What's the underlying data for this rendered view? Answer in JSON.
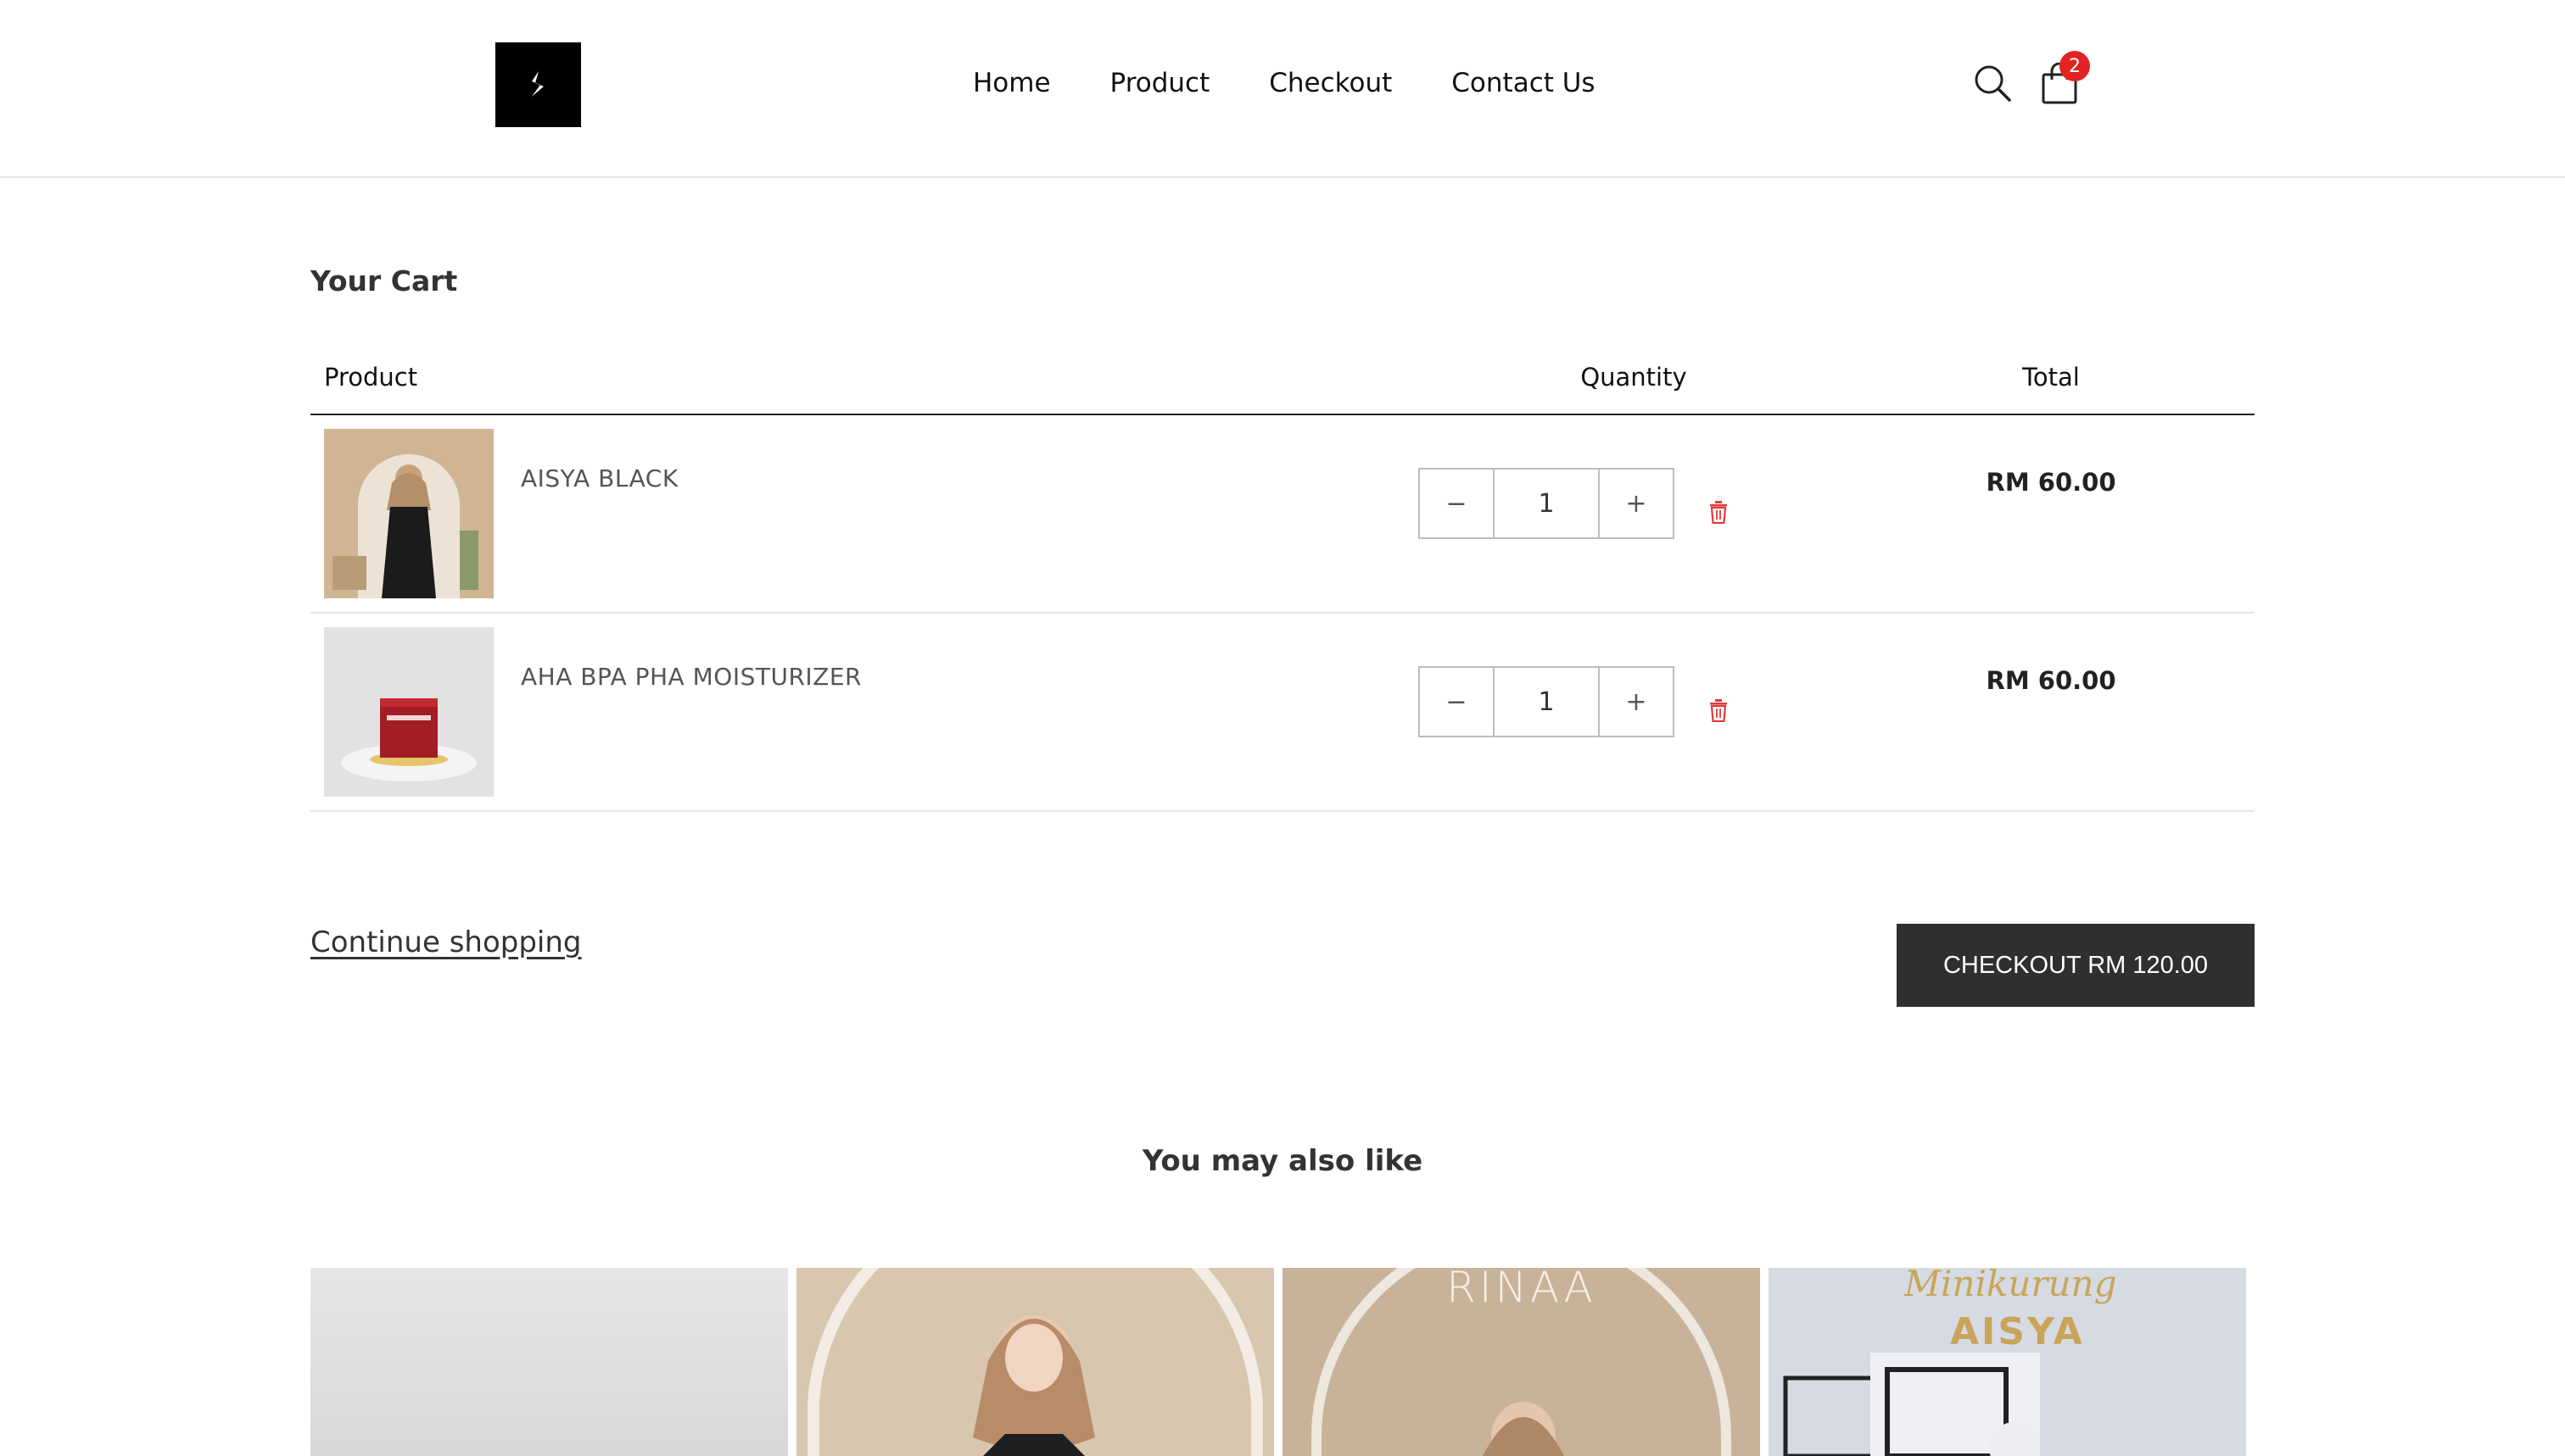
{
  "header": {
    "logo_alt": "store-logo",
    "nav": [
      {
        "label": "Home"
      },
      {
        "label": "Product"
      },
      {
        "label": "Checkout"
      },
      {
        "label": "Contact Us"
      }
    ],
    "cart_count": "2",
    "icons": {
      "search": "search-icon",
      "cart": "shopping-bag-icon"
    }
  },
  "cart": {
    "title": "Your Cart",
    "columns": {
      "product": "Product",
      "quantity": "Quantity",
      "total": "Total"
    },
    "items": [
      {
        "name": "AISYA BLACK",
        "quantity": "1",
        "total": "RM 60.00",
        "minus": "−",
        "plus": "+"
      },
      {
        "name": "AHA BPA PHA MOISTURIZER",
        "quantity": "1",
        "total": "RM 60.00",
        "minus": "−",
        "plus": "+"
      }
    ],
    "continue_label": "Continue shopping",
    "checkout_label": "CHECKOUT RM 120.00"
  },
  "recommendations": {
    "heading": "You may also like",
    "cards": [
      {
        "overlay": ""
      },
      {
        "overlay": ""
      },
      {
        "overlay": "RINAA"
      },
      {
        "overlay": "Minikurung",
        "overlay2": "AISYA"
      }
    ]
  },
  "colors": {
    "accent": "#2f2f2f",
    "badge": "#e02424",
    "trash": "#e03a3a"
  }
}
